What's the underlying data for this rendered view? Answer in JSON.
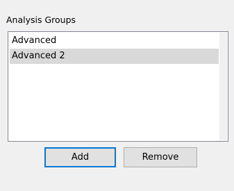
{
  "group": {
    "label": "Analysis Groups"
  },
  "list": {
    "items": [
      {
        "label": "Advanced",
        "selected": false
      },
      {
        "label": "Advanced 2",
        "selected": true
      }
    ]
  },
  "buttons": {
    "add_label": "Add",
    "remove_label": "Remove"
  },
  "colors": {
    "selection_bg": "#d9d9d9",
    "default_button_border": "#0078d7",
    "button_bg": "#e1e1e1"
  }
}
